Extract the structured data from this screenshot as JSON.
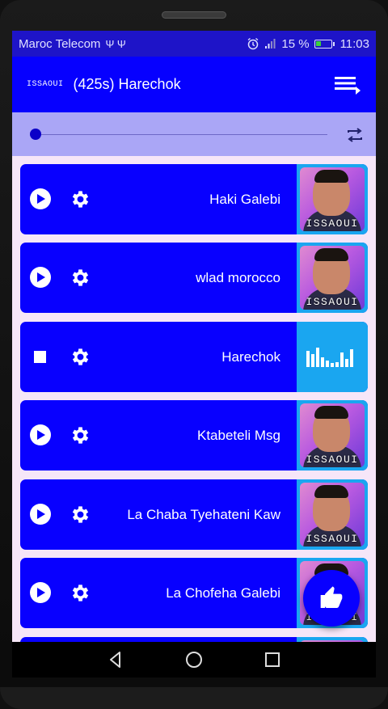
{
  "status_bar": {
    "carrier": "Maroc Telecom",
    "usb_icons": "Ψ Ψ",
    "battery_percent": "15 %",
    "time": "11:03"
  },
  "header": {
    "logo_text": "ISSAOUI",
    "title": "(425s) Harechok"
  },
  "player": {
    "progress": 0.0
  },
  "songs": [
    {
      "title": "Haki Galebi",
      "state": "paused",
      "thumb_caption": "ISSAOUI"
    },
    {
      "title": "wlad morocco",
      "state": "paused",
      "thumb_caption": "ISSAOUI"
    },
    {
      "title": "Harechok",
      "state": "playing"
    },
    {
      "title": "Ktabeteli Msg",
      "state": "paused",
      "thumb_caption": "ISSAOUI"
    },
    {
      "title": "La Chaba Tyehateni Kaw",
      "state": "paused",
      "thumb_caption": "ISSAOUI"
    },
    {
      "title": "La Chofeha Galebi",
      "state": "paused",
      "thumb_caption": "ISSAOUI"
    }
  ],
  "colors": {
    "primary": "#0600ff",
    "status_bar": "#1e14c8",
    "player_bar": "#aaa6f6",
    "list_background": "#f6e6f8",
    "now_playing": "#1aa6f0"
  }
}
